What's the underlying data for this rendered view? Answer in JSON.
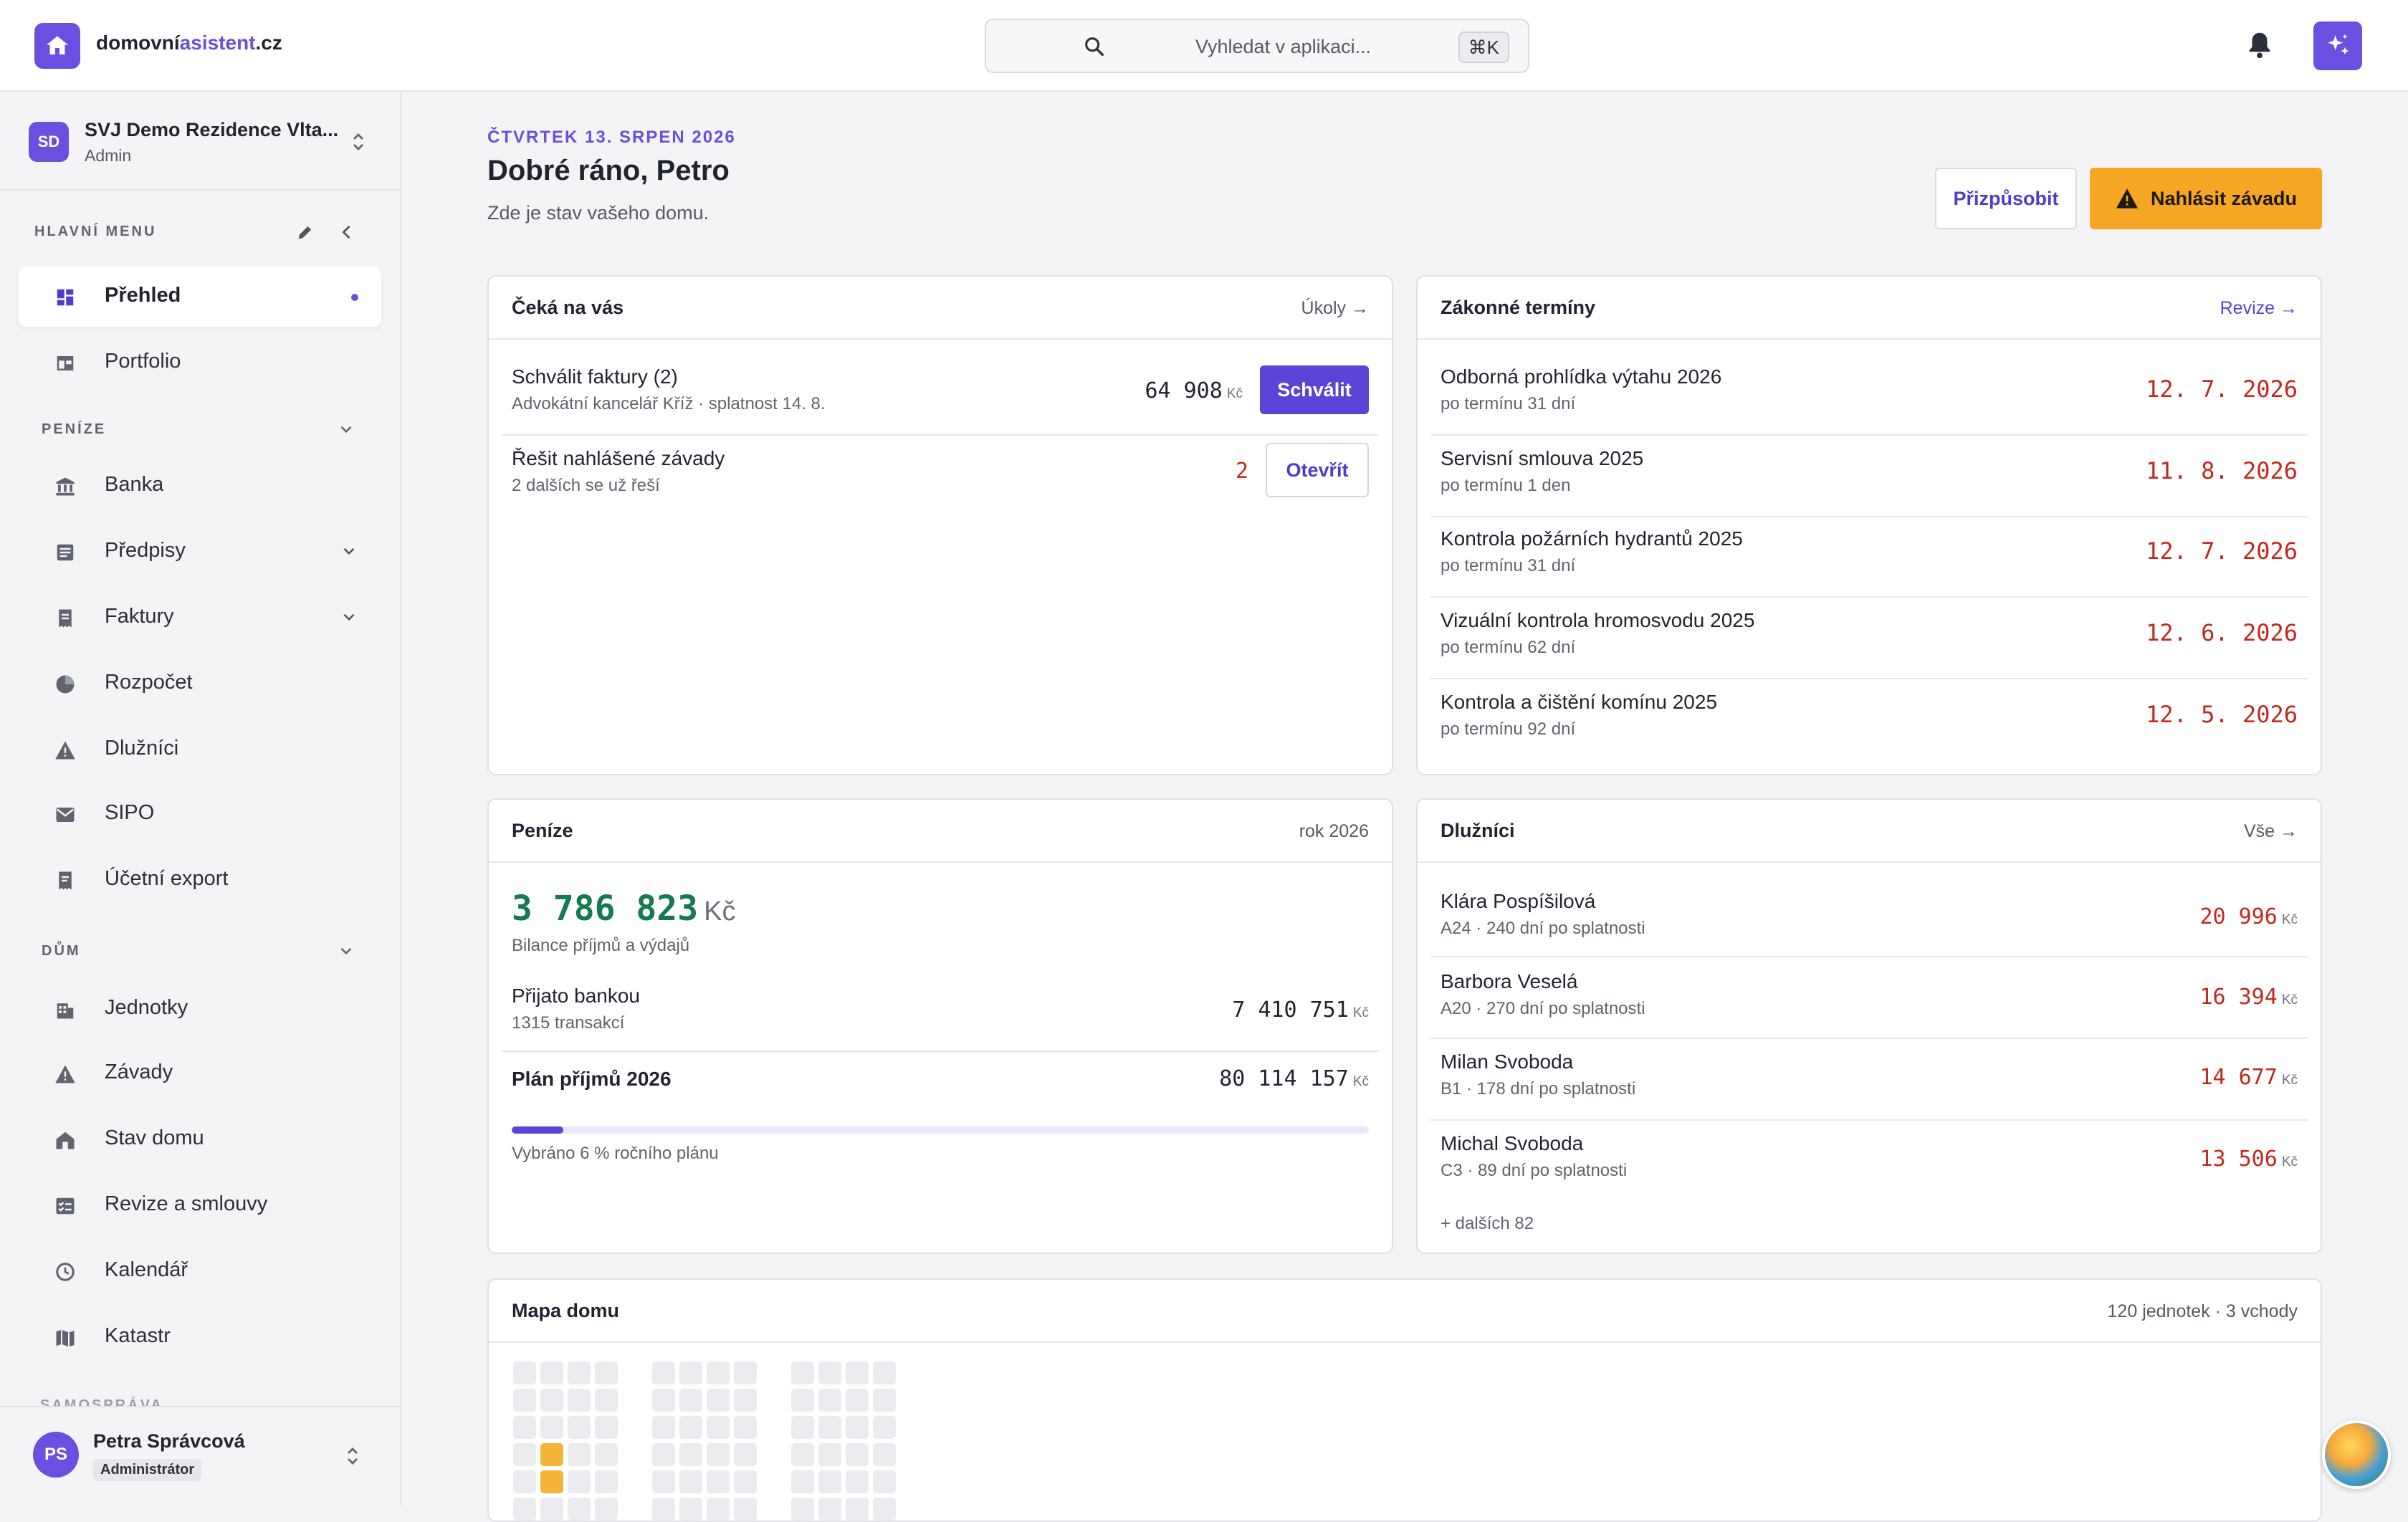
{
  "app": {
    "brand_prefix": "domovní",
    "brand_accent": "asistent",
    "brand_suffix": ".cz",
    "accent_color": "#6a4fe0"
  },
  "search": {
    "placeholder": "Vyhledat v aplikaci...",
    "shortcut": "⌘K"
  },
  "org": {
    "initials": "SD",
    "name": "SVJ Demo Rezidence Vlta...",
    "role": "Admin"
  },
  "sidebar": {
    "main_menu_label": "HLAVNÍ MENU",
    "sections": [
      {
        "label": "PENÍZE"
      },
      {
        "label": "DŮM"
      },
      {
        "label": "SAMOSPRÁVA"
      }
    ],
    "items": [
      {
        "label": "Přehled",
        "icon": "dashboard-icon"
      },
      {
        "label": "Portfolio",
        "icon": "portfolio-icon"
      },
      {
        "label": "Banka",
        "icon": "bank-icon"
      },
      {
        "label": "Předpisy",
        "icon": "document-list-icon"
      },
      {
        "label": "Faktury",
        "icon": "invoice-icon"
      },
      {
        "label": "Rozpočet",
        "icon": "pie-chart-icon"
      },
      {
        "label": "Dlužníci",
        "icon": "warning-icon"
      },
      {
        "label": "SIPO",
        "icon": "mail-icon"
      },
      {
        "label": "Účetní export",
        "icon": "export-icon"
      },
      {
        "label": "Jednotky",
        "icon": "building-icon"
      },
      {
        "label": "Závady",
        "icon": "warning-icon"
      },
      {
        "label": "Stav domu",
        "icon": "house-status-icon"
      },
      {
        "label": "Revize a smlouvy",
        "icon": "checklist-icon"
      },
      {
        "label": "Kalendář",
        "icon": "clock-icon"
      },
      {
        "label": "Katastr",
        "icon": "map-icon"
      }
    ]
  },
  "user": {
    "initials": "PS",
    "name": "Petra Správcová",
    "role": "Administrátor"
  },
  "header": {
    "date": "ČTVRTEK 13. SRPEN 2026",
    "greeting": "Dobré ráno, Petro",
    "subtitle": "Zde je stav vašeho domu.",
    "customize_label": "Přizpůsobit",
    "report_label": "Nahlásit závadu"
  },
  "tasks": {
    "title": "Čeká na vás",
    "link": "Úkoly →",
    "items": [
      {
        "title": "Schválit faktury (2)",
        "subtitle": "Advokátní kancelář Kříž · splatnost 14. 8.",
        "amount": "64 908",
        "currency": "Kč",
        "action": "Schválit"
      },
      {
        "title": "Řešit nahlášené závady",
        "subtitle": "2 dalších se už řeší",
        "count": "2",
        "action": "Otevřít"
      }
    ]
  },
  "deadlines": {
    "title": "Zákonné termíny",
    "link": "Revize →",
    "items": [
      {
        "title": "Odborná prohlídka výtahu 2026",
        "subtitle": "po termínu 31 dní",
        "date": "12. 7. 2026"
      },
      {
        "title": "Servisní smlouva 2025",
        "subtitle": "po termínu 1 den",
        "date": "11. 8. 2026"
      },
      {
        "title": "Kontrola požárních hydrantů 2025",
        "subtitle": "po termínu 31 dní",
        "date": "12. 7. 2026"
      },
      {
        "title": "Vizuální kontrola hromosvodu 2025",
        "subtitle": "po termínu 62 dní",
        "date": "12. 6. 2026"
      },
      {
        "title": "Kontrola a čištění komínu 2025",
        "subtitle": "po termínu 92 dní",
        "date": "12. 5. 2026"
      }
    ]
  },
  "money": {
    "title": "Peníze",
    "year": "rok 2026",
    "balance": "3 786 823",
    "currency": "Kč",
    "balance_label": "Bilance příjmů a výdajů",
    "received_label": "Přijato bankou",
    "received_sub": "1315 transakcí",
    "received_amount": "7 410 751",
    "plan_label": "Plán příjmů 2026",
    "plan_amount": "80 114 157",
    "progress_percent": 6,
    "progress_label": "Vybráno 6 % ročního plánu"
  },
  "debtors": {
    "title": "Dlužníci",
    "link": "Vše →",
    "items": [
      {
        "name": "Klára Pospíšilová",
        "detail": "A24 · 240 dní po splatnosti",
        "amount": "20 996"
      },
      {
        "name": "Barbora Veselá",
        "detail": "A20 · 270 dní po splatnosti",
        "amount": "16 394"
      },
      {
        "name": "Milan Svoboda",
        "detail": "B1 · 178 dní po splatnosti",
        "amount": "14 677"
      },
      {
        "name": "Michal Svoboda",
        "detail": "C3 · 89 dní po splatnosti",
        "amount": "13 506"
      }
    ],
    "currency": "Kč",
    "more": "+ dalších 82"
  },
  "map": {
    "title": "Mapa domu",
    "summary": "120 jednotek · 3 vchody",
    "highlight_color": "#f5b53a"
  }
}
